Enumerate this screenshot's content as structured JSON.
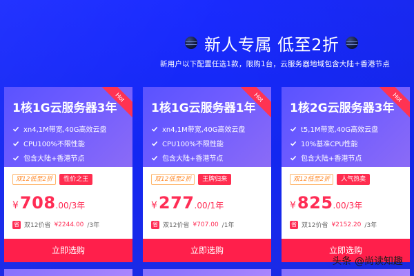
{
  "header": {
    "title": "新人专属 低至2折",
    "subtitle": "新用户以下配置任选1款，限购1台，云服务器地域包含大陆+香港节点"
  },
  "cards": [
    {
      "name": "1核1G云服务器3年",
      "hot_label": "Hot",
      "features": [
        "xn4,1M带宽,40G高效云盘",
        "CPU100%不限性能",
        "包含大陆+香港节点"
      ],
      "promo_tag": "双12低至2折",
      "hot_tag": "性价之王",
      "currency": "¥",
      "price": "708",
      "price_unit": ".00/3年",
      "save_badge": "省",
      "save_prefix": "双12价省",
      "save_amount": "¥2244.00",
      "save_suffix": "/3年",
      "button": "立即选购"
    },
    {
      "name": "1核1G云服务器1年",
      "hot_label": "Hot",
      "features": [
        "xn4,1M带宽,40G高效云盘",
        "CPU100%不限性能",
        "包含大陆+香港节点"
      ],
      "promo_tag": "双12低至2折",
      "hot_tag": "王牌归来",
      "currency": "¥",
      "price": "277",
      "price_unit": ".00/1年",
      "save_badge": "省",
      "save_prefix": "双12价省",
      "save_amount": "¥707.00",
      "save_suffix": "/1年",
      "button": "立即选购"
    },
    {
      "name": "1核2G云服务器3年",
      "hot_label": "Hot",
      "features": [
        "t5,1M带宽,40G高效云盘",
        "10%基准CPU性能",
        "包含大陆+香港节点"
      ],
      "promo_tag": "双12低至2折",
      "hot_tag": "人气热卖",
      "currency": "¥",
      "price": "825",
      "price_unit": ".00/3年",
      "save_badge": "省",
      "save_prefix": "双12价省",
      "save_amount": "¥2152.20",
      "save_suffix": "/3年",
      "button": "立即选购"
    }
  ],
  "watermark": "头条 @尚读知趣",
  "colors": {
    "background": "#1327f2",
    "card_gradient_start": "#5a53ff",
    "accent_red": "#ff2d55",
    "button": "#ff1f4b",
    "promo_orange": "#ff8a2b"
  },
  "icons": {
    "feature": "check-icon",
    "title_decor": "orb-icon"
  }
}
